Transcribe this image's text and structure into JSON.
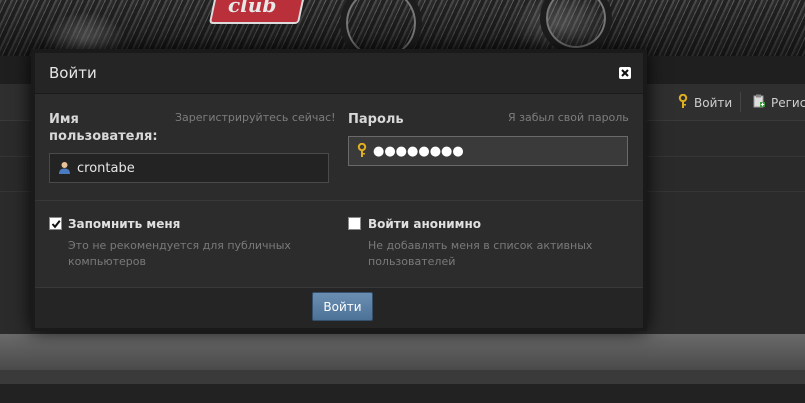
{
  "header_nav": {
    "login_label": "Войти",
    "register_label": "Регист"
  },
  "modal": {
    "title": "Войти",
    "username": {
      "label_line1": "Имя",
      "label_line2": "пользователя:",
      "register_link": "Зарегистрируйтесь сейчас!",
      "value": "crontabe"
    },
    "password": {
      "label": "Пароль",
      "forgot_link": "Я забыл свой пароль",
      "masked_value": "●●●●●●●●"
    },
    "remember": {
      "label": "Запомнить меня",
      "description": "Это не рекомендуется для публичных компьютеров",
      "checked": true
    },
    "anonymous": {
      "label": "Войти анонимно",
      "description": "Не добавлять меня в список активных пользователей",
      "checked": false
    },
    "submit_label": "Войти"
  },
  "colors": {
    "accent_button": "#5a7fa5",
    "key_icon": "#e0b020"
  }
}
